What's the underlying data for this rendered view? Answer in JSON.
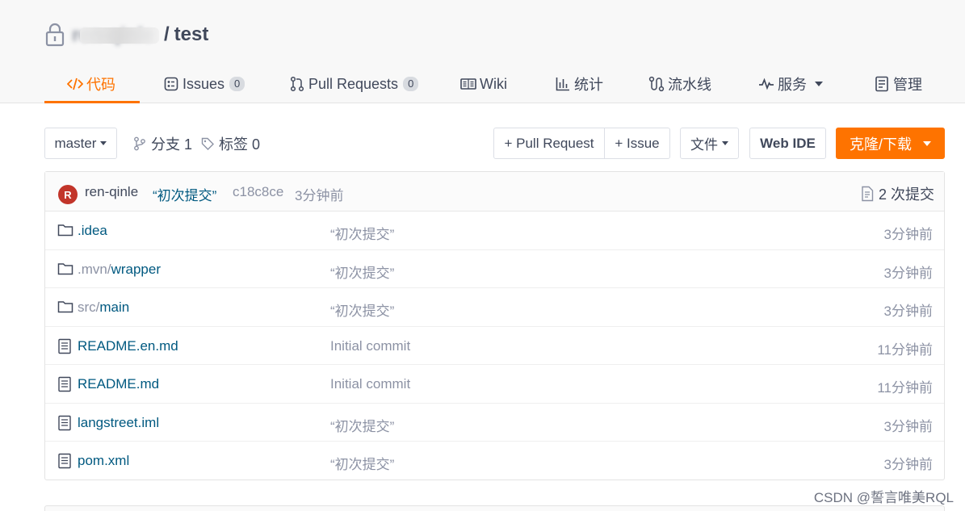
{
  "repo": {
    "owner_blurred": "ren-qinle",
    "separator": "/",
    "name": "test"
  },
  "nav": {
    "items": [
      {
        "label": "代码",
        "icon": "code-icon",
        "active": true
      },
      {
        "label": "Issues",
        "icon": "issues-icon",
        "badge": "0"
      },
      {
        "label": "Pull Requests",
        "icon": "pull-request-icon",
        "badge": "0"
      },
      {
        "label": "Wiki",
        "icon": "wiki-icon"
      },
      {
        "label": "统计",
        "icon": "stats-icon"
      },
      {
        "label": "流水线",
        "icon": "pipeline-icon"
      },
      {
        "label": "服务",
        "icon": "service-icon",
        "dropdown": true
      },
      {
        "label": "管理",
        "icon": "manage-icon"
      }
    ]
  },
  "toolbar": {
    "branch": "master",
    "branches": "分支 1",
    "tags": "标签 0",
    "pull_request": "+ Pull Request",
    "issue": "+ Issue",
    "file": "文件",
    "web_ide": "Web IDE",
    "clone": "克隆/下载"
  },
  "commit": {
    "avatar_letter": "R",
    "author": "ren-qinle",
    "message": "“初次提交”",
    "sha": "c18c8ce",
    "time": "3分钟前",
    "count": "2 次提交"
  },
  "files": [
    {
      "type": "folder",
      "prefix": "",
      "name": ".idea",
      "message": "“初次提交”",
      "time": "3分钟前"
    },
    {
      "type": "folder",
      "prefix": ".mvn/",
      "name": "wrapper",
      "message": "“初次提交”",
      "time": "3分钟前"
    },
    {
      "type": "folder",
      "prefix": "src/",
      "name": "main",
      "message": "“初次提交”",
      "time": "3分钟前"
    },
    {
      "type": "file",
      "prefix": "",
      "name": "README.en.md",
      "message": "Initial commit",
      "time": "11分钟前"
    },
    {
      "type": "file",
      "prefix": "",
      "name": "README.md",
      "message": "Initial commit",
      "time": "11分钟前"
    },
    {
      "type": "file",
      "prefix": "",
      "name": "langstreet.iml",
      "message": "“初次提交”",
      "time": "3分钟前"
    },
    {
      "type": "file",
      "prefix": "",
      "name": "pom.xml",
      "message": "“初次提交”",
      "time": "3分钟前"
    }
  ],
  "watermark": "CSDN @誓言唯美RQL",
  "colors": {
    "accent": "#fe7300",
    "link": "#005980",
    "muted": "#8c92a4",
    "text": "#40485b",
    "avatar": "#c2352a"
  }
}
